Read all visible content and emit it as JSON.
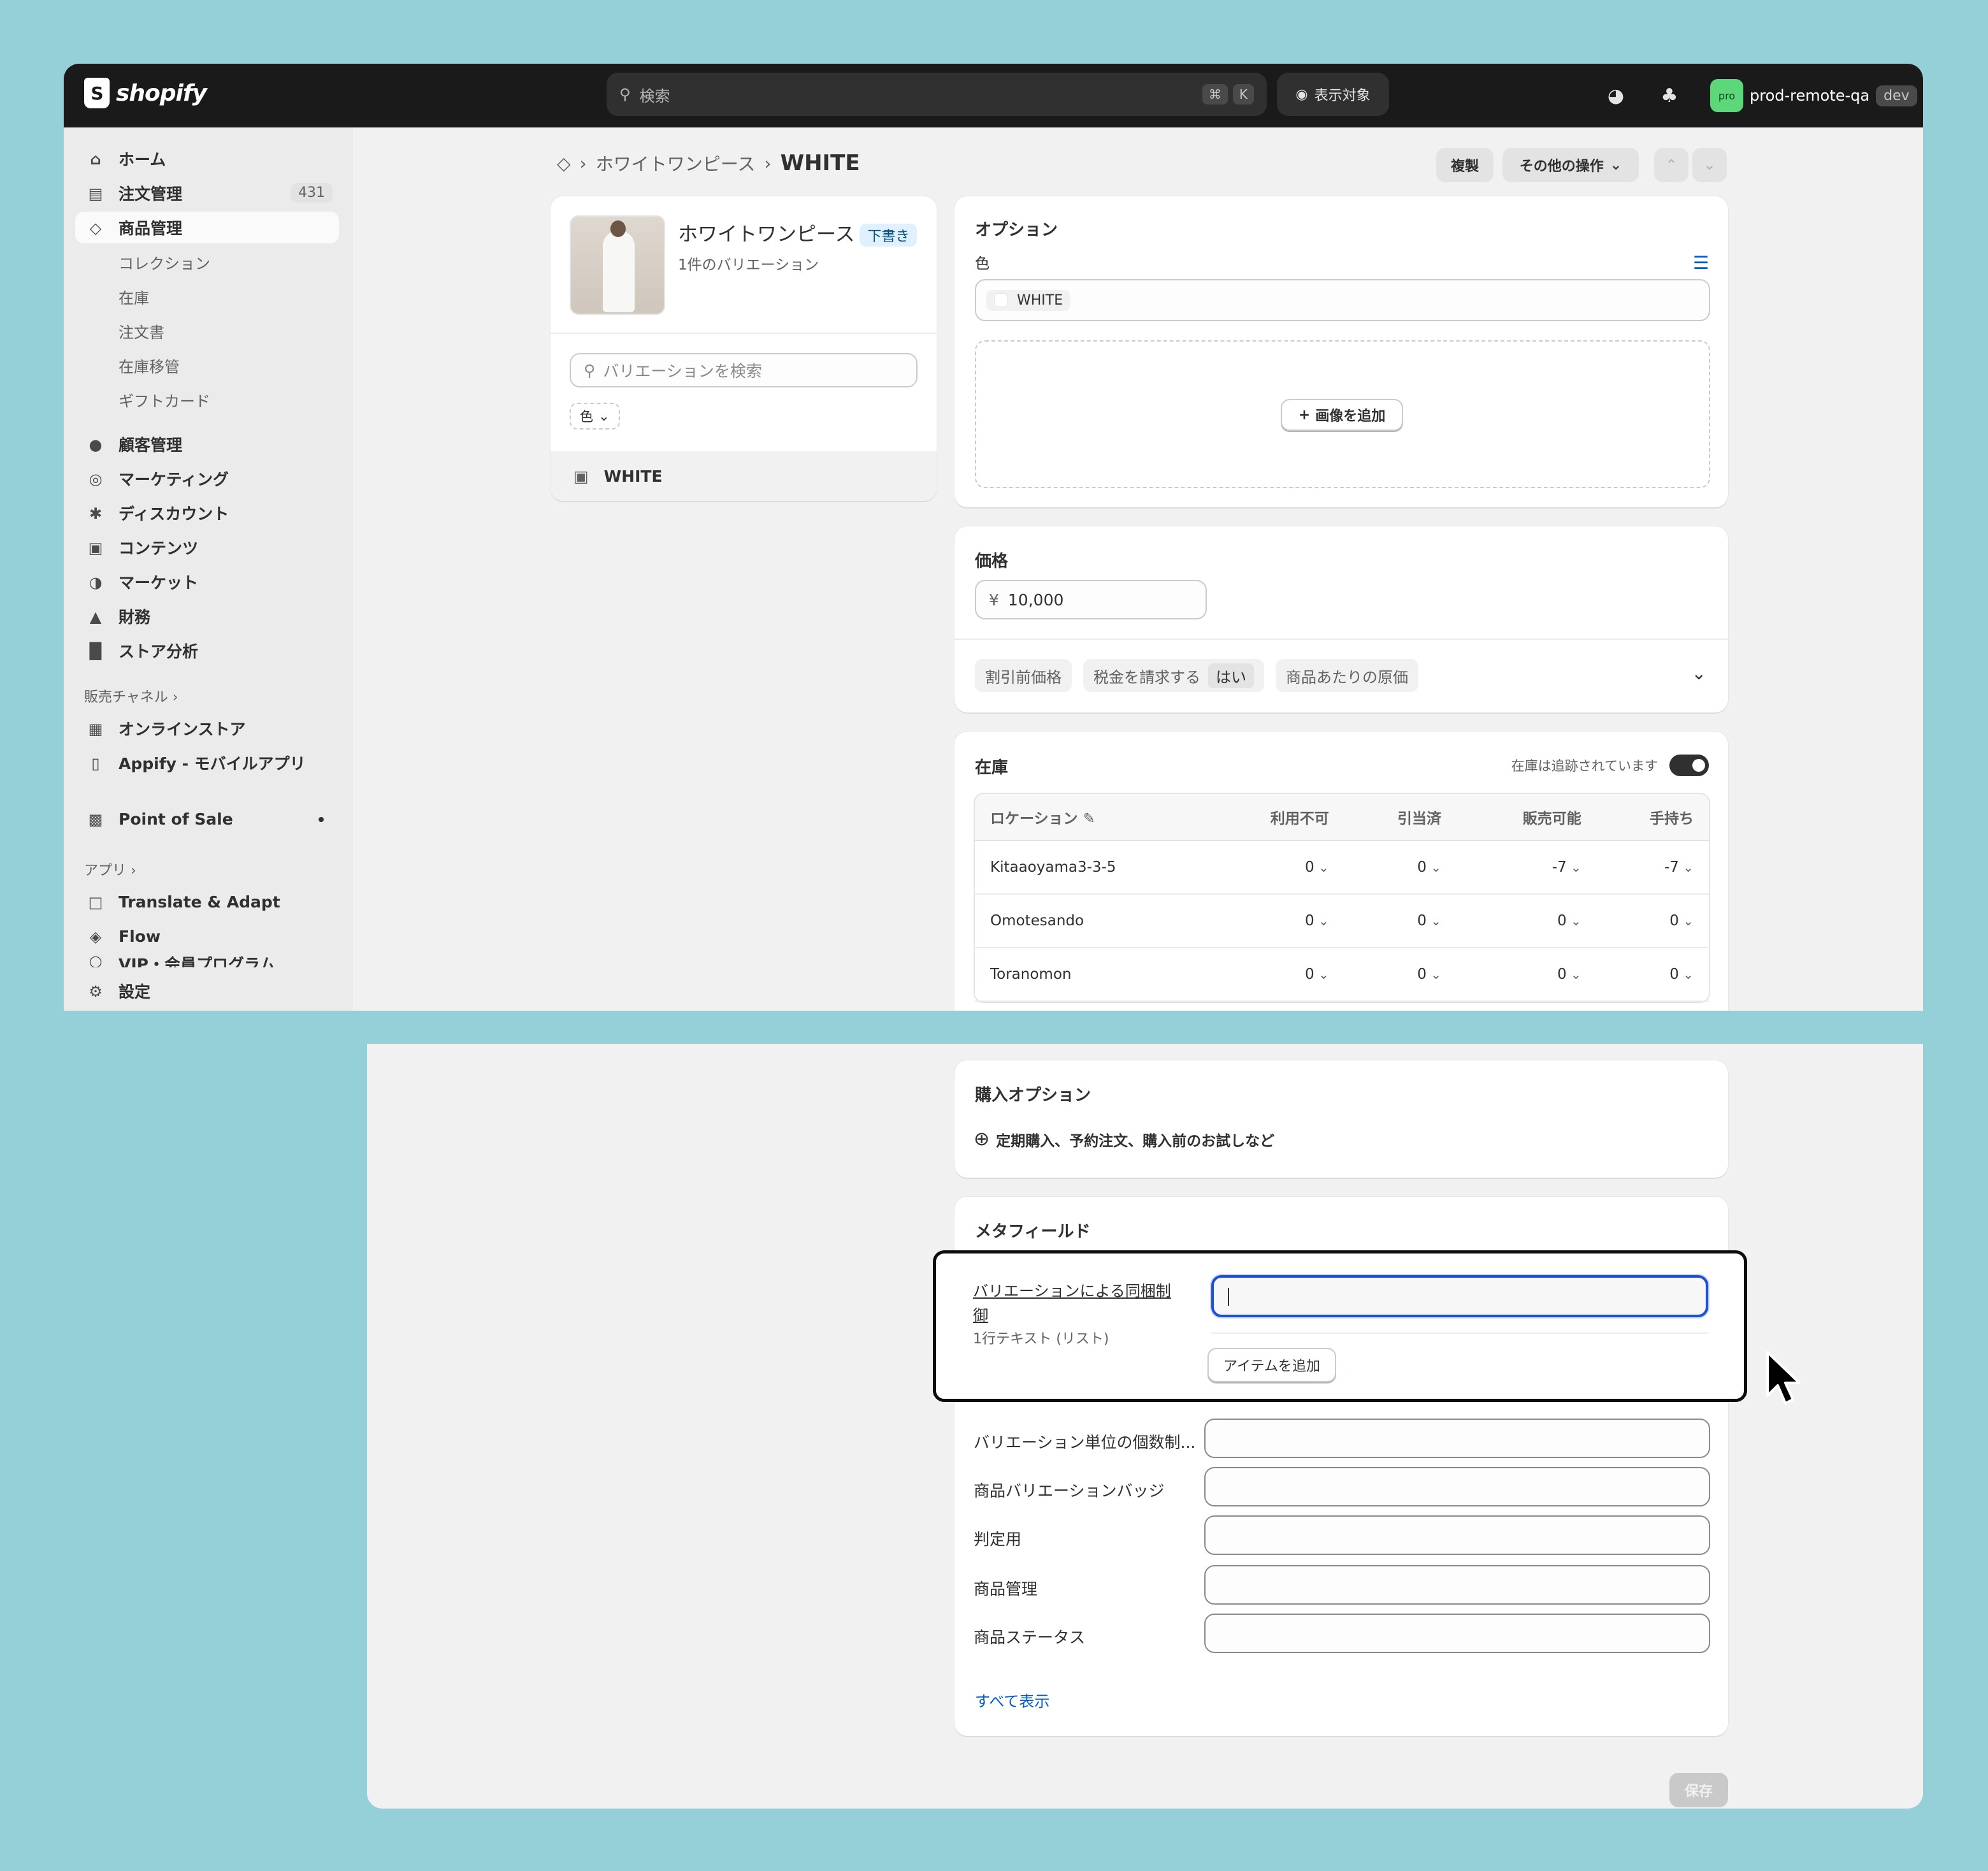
{
  "topbar": {
    "logo_text": "shopify",
    "search_placeholder": "検索",
    "shortcut_keys": [
      "⌘",
      "K"
    ],
    "view_target_label": "表示対象",
    "account_avatar": "pro",
    "account_name": "prod-remote-qa",
    "account_badge": "dev"
  },
  "sidebar": {
    "items": [
      {
        "label": "ホーム",
        "icon": "home-icon"
      },
      {
        "label": "注文管理",
        "icon": "inbox-icon",
        "badge": "431"
      },
      {
        "label": "商品管理",
        "icon": "tag-icon"
      },
      {
        "label": "コレクション"
      },
      {
        "label": "在庫"
      },
      {
        "label": "注文書"
      },
      {
        "label": "在庫移管"
      },
      {
        "label": "ギフトカード"
      },
      {
        "label": "顧客管理",
        "icon": "person-icon"
      },
      {
        "label": "マーケティング",
        "icon": "target-icon"
      },
      {
        "label": "ディスカウント",
        "icon": "discount-icon"
      },
      {
        "label": "コンテンツ",
        "icon": "content-icon"
      },
      {
        "label": "マーケット",
        "icon": "globe-icon"
      },
      {
        "label": "財務",
        "icon": "bank-icon"
      },
      {
        "label": "ストア分析",
        "icon": "chart-icon"
      }
    ],
    "sales_channels_heading": "販売チャネル",
    "channels": [
      {
        "label": "オンラインストア"
      },
      {
        "label": "Appify - モバイルアプリ"
      },
      {
        "label": "Point of Sale"
      }
    ],
    "apps_heading": "アプリ",
    "apps": [
      {
        "label": "Translate & Adapt"
      },
      {
        "label": "Flow"
      },
      {
        "label": "VIP・会員プログラム"
      }
    ],
    "settings_label": "設定"
  },
  "breadcrumb": {
    "parent": "ホワイトワンピース",
    "current": "WHITE"
  },
  "header_actions": {
    "duplicate": "複製",
    "more_actions": "その他の操作"
  },
  "product_card": {
    "title": "ホワイトワンピース",
    "status": "下書き",
    "variant_count": "1件のバリエーション",
    "search_placeholder": "バリエーションを検索",
    "filter_label": "色",
    "variant_name": "WHITE"
  },
  "options_card": {
    "title": "オプション",
    "option_name": "色",
    "option_value": "WHITE",
    "add_image": "画像を追加"
  },
  "price_card": {
    "title": "価格",
    "currency": "¥",
    "price": "10,000",
    "compare_at": "割引前価格",
    "charge_tax": "税金を請求する",
    "charge_tax_value": "はい",
    "cost_per_item": "商品あたりの原価"
  },
  "inventory_card": {
    "title": "在庫",
    "tracking_label": "在庫は追跡されています",
    "columns": [
      "ロケーション",
      "利用不可",
      "引当済",
      "販売可能",
      "手持ち"
    ],
    "rows": [
      {
        "location": "Kitaaoyama3-3-5",
        "unavailable": "0",
        "committed": "0",
        "available": "-7",
        "on_hand": "-7"
      },
      {
        "location": "Omotesando",
        "unavailable": "0",
        "committed": "0",
        "available": "0",
        "on_hand": "0"
      },
      {
        "location": "Toranomon",
        "unavailable": "0",
        "committed": "0",
        "available": "0",
        "on_hand": "0"
      }
    ]
  },
  "purchase_options_card": {
    "title": "購入オプション",
    "add_label": "定期購入、予約注文、購入前のお試しなど"
  },
  "metafields_card": {
    "title": "メタフィールド",
    "focused_field": {
      "label": "バリエーションによる同梱制御",
      "type": "1行テキスト (リスト)",
      "value": "",
      "add_item": "アイテムを追加"
    },
    "fields": [
      "バリエーション単位の個数制...",
      "商品バリエーションバッジ",
      "判定用",
      "商品管理",
      "商品ステータス"
    ],
    "show_all": "すべて表示"
  },
  "save_label": "保存",
  "colors": {
    "background": "#95d0d8",
    "topbar": "#1a1a1a",
    "link": "#005bd3",
    "draft_badge": "#e0f0ff"
  }
}
